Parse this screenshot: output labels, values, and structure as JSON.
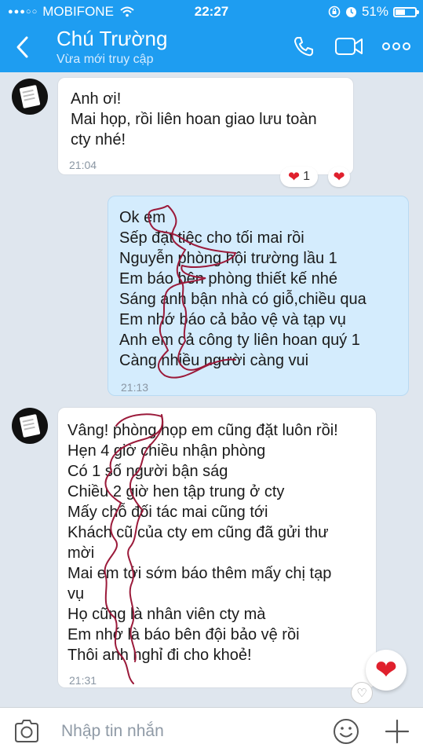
{
  "status_bar": {
    "carrier": "MOBIFONE",
    "time": "22:27",
    "battery": "51%",
    "battery_level": 0.51
  },
  "header": {
    "title": "Chú Trường",
    "subtitle": "Vừa mới truy cập",
    "icons": [
      "back-icon",
      "phone-icon",
      "video-icon",
      "more-icon"
    ]
  },
  "messages": [
    {
      "direction": "in",
      "lines": [
        "Anh ơi!",
        "Mai họp, rồi liên hoan giao lưu toàn",
        "cty nhé!"
      ],
      "time": "21:04",
      "reaction_count": "1"
    },
    {
      "direction": "out",
      "lines": [
        "Ok em",
        "Sếp đặt tiệc cho tối mai rồi",
        "Nguyễn phòng hội trường lầu 1",
        "Em báo bên phòng thiết kế nhé",
        "Sáng anh bận nhà có giỗ,chiều qua",
        "Em nhớ báo cả bảo vệ và tạp vụ",
        "Anh em cả công ty liên hoan quý 1",
        "Càng nhiều người càng vui"
      ],
      "time": "21:13"
    },
    {
      "direction": "in",
      "lines": [
        "Vâng! phòng họp em cũng đặt luôn rồi!",
        "Hẹn 4 giờ chiều nhận phòng",
        "Có 1 số người bận ság",
        "Chiều 2 giờ hen tập trung ở cty",
        "Mấy chỗ đối tác mai cũng tới",
        "Khách cũ của cty em cũng đã gửi thư",
        "mời",
        "Mai em tới sớm báo thêm mấy chị tạp",
        "vụ",
        "Họ cũng là nhân viên cty mà",
        "Em nhớ là báo bên đội bảo vệ rồi",
        "Thôi anh nghỉ đi cho khoẻ!"
      ],
      "time": "21:31"
    }
  ],
  "input": {
    "placeholder": "Nhập tin nhắn"
  },
  "colors": {
    "header": "#1e9df1",
    "background": "#dfe6ee",
    "outgoing_bubble": "#d4ecfd",
    "incoming_bubble": "#ffffff",
    "heart": "#e0202d",
    "scribble": "#9b1a3a"
  }
}
